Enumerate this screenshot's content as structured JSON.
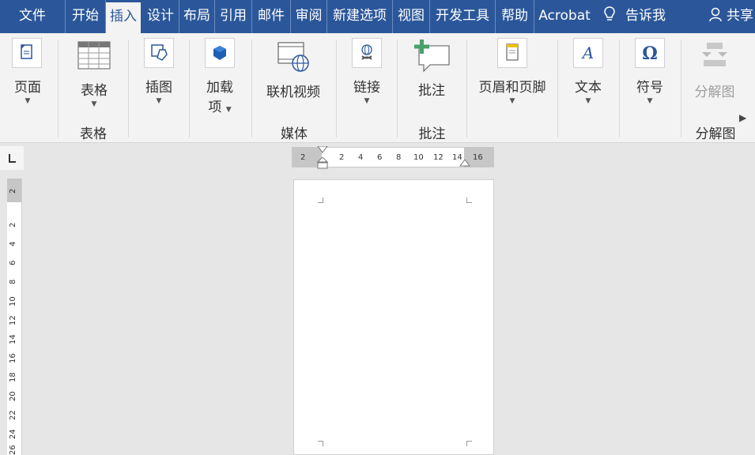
{
  "tabs": [
    {
      "label": "文件"
    },
    {
      "label": "开始"
    },
    {
      "label": "插入"
    },
    {
      "label": "设计"
    },
    {
      "label": "布局"
    },
    {
      "label": "引用"
    },
    {
      "label": "邮件"
    },
    {
      "label": "审阅"
    },
    {
      "label": "新建选项"
    },
    {
      "label": "视图"
    },
    {
      "label": "开发工具"
    },
    {
      "label": "帮助"
    },
    {
      "label": "Acrobat"
    }
  ],
  "active_tab": "插入",
  "tell_me": "告诉我",
  "share": "共享",
  "ribbon": {
    "buttons": {
      "page": "页面",
      "table": "表格",
      "illustrations": "插图",
      "addins_1": "加载",
      "addins_2": "项",
      "online_video": "联机视频",
      "link": "链接",
      "comment": "批注",
      "header_footer": "页眉和页脚",
      "text": "文本",
      "symbols": "符号",
      "exploded_view": "分解图"
    },
    "groups": {
      "table": "表格",
      "media": "媒体",
      "comments": "批注",
      "exploded_view": "分解图"
    }
  },
  "ruler": {
    "horizontal": [
      "2",
      "2",
      "4",
      "6",
      "8",
      "10",
      "12",
      "14",
      "16"
    ],
    "vertical": [
      "2",
      "2",
      "4",
      "6",
      "8",
      "10",
      "12",
      "14",
      "16",
      "18",
      "20",
      "22",
      "24",
      "26"
    ]
  },
  "colors": {
    "titlebar": "#2b579a",
    "ribbon_bg": "#f3f3f3",
    "canvas_bg": "#e6e6e6"
  }
}
